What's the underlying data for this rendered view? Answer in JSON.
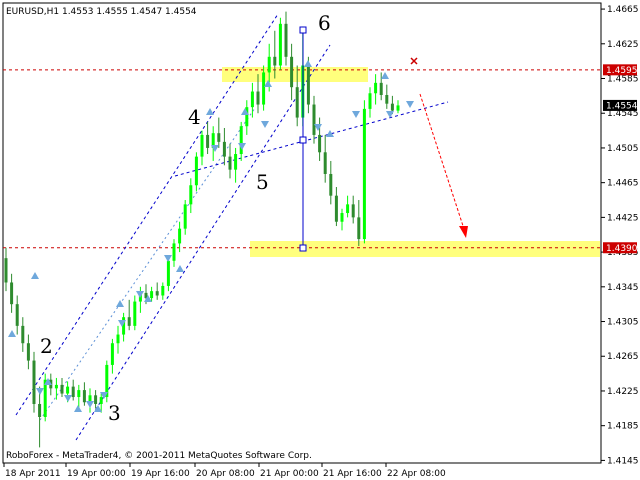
{
  "window": {
    "symbol_header": "EURUSD,H1  1.4553 1.4555 1.4547 1.4554",
    "footer": "RoboForex - MetaTrader4, © 2001-2011 MetaQuotes Software Corp."
  },
  "colors": {
    "bull": "#00ff00",
    "bear": "#2e8b2e",
    "line_blue": "#0000cc",
    "arrow_blue": "#6fa8dc",
    "level_red": "#cc0000",
    "zone_yellow": "#ffff66",
    "target_red": "#ff0000",
    "last_price_bg": "#000000"
  },
  "chart_data": {
    "type": "candlestick",
    "symbol": "EURUSD",
    "timeframe": "H1",
    "ylim": [
      1.4142,
      1.4672
    ],
    "y_ticks": [
      "1.4665",
      "1.4625",
      "1.4585",
      "1.4545",
      "1.4505",
      "1.4465",
      "1.4425",
      "1.4385",
      "1.4345",
      "1.4305",
      "1.4265",
      "1.4225",
      "1.4185",
      "1.4145"
    ],
    "x_ticks": [
      "18 Apr 2011",
      "19 Apr 00:00",
      "19 Apr 16:00",
      "20 Apr 08:00",
      "21 Apr 00:00",
      "21 Apr 16:00",
      "22 Apr 08:00"
    ],
    "price_levels": [
      {
        "label": "1.4595",
        "value": 1.4595
      },
      {
        "label": "1.4390",
        "value": 1.439
      }
    ],
    "last_price": {
      "label": "1.4554",
      "value": 1.4554
    },
    "wave_labels": [
      "2",
      "3",
      "4",
      "5",
      "6"
    ],
    "series": [
      {
        "values": [
          {
            "o": 1.4378,
            "h": 1.439,
            "l": 1.434,
            "c": 1.435
          },
          {
            "o": 1.435,
            "h": 1.436,
            "l": 1.4315,
            "c": 1.4325
          },
          {
            "o": 1.4325,
            "h": 1.4335,
            "l": 1.429,
            "c": 1.43
          },
          {
            "o": 1.43,
            "h": 1.431,
            "l": 1.427,
            "c": 1.428
          },
          {
            "o": 1.428,
            "h": 1.429,
            "l": 1.425,
            "c": 1.426
          },
          {
            "o": 1.426,
            "h": 1.427,
            "l": 1.42,
            "c": 1.421
          },
          {
            "o": 1.421,
            "h": 1.423,
            "l": 1.416,
            "c": 1.4195
          },
          {
            "o": 1.4195,
            "h": 1.4245,
            "l": 1.419,
            "c": 1.4238
          },
          {
            "o": 1.4238,
            "h": 1.4245,
            "l": 1.422,
            "c": 1.4228
          },
          {
            "o": 1.4228,
            "h": 1.424,
            "l": 1.4215,
            "c": 1.4232
          },
          {
            "o": 1.4232,
            "h": 1.424,
            "l": 1.4218,
            "c": 1.4222
          },
          {
            "o": 1.4222,
            "h": 1.4236,
            "l": 1.4212,
            "c": 1.423
          },
          {
            "o": 1.423,
            "h": 1.4238,
            "l": 1.4214,
            "c": 1.4218
          },
          {
            "o": 1.4218,
            "h": 1.4232,
            "l": 1.4205,
            "c": 1.4226
          },
          {
            "o": 1.4226,
            "h": 1.4235,
            "l": 1.4208,
            "c": 1.4212
          },
          {
            "o": 1.4212,
            "h": 1.4228,
            "l": 1.42,
            "c": 1.422
          },
          {
            "o": 1.422,
            "h": 1.4226,
            "l": 1.4205,
            "c": 1.421
          },
          {
            "o": 1.421,
            "h": 1.4222,
            "l": 1.42,
            "c": 1.4218
          },
          {
            "o": 1.4218,
            "h": 1.426,
            "l": 1.4212,
            "c": 1.4255
          },
          {
            "o": 1.4255,
            "h": 1.4285,
            "l": 1.4245,
            "c": 1.428
          },
          {
            "o": 1.428,
            "h": 1.43,
            "l": 1.4268,
            "c": 1.429
          },
          {
            "o": 1.429,
            "h": 1.4315,
            "l": 1.4282,
            "c": 1.431
          },
          {
            "o": 1.431,
            "h": 1.433,
            "l": 1.4295,
            "c": 1.43
          },
          {
            "o": 1.43,
            "h": 1.4335,
            "l": 1.4295,
            "c": 1.4328
          },
          {
            "o": 1.4328,
            "h": 1.4345,
            "l": 1.4315,
            "c": 1.4338
          },
          {
            "o": 1.4338,
            "h": 1.4348,
            "l": 1.4325,
            "c": 1.4332
          },
          {
            "o": 1.4332,
            "h": 1.4345,
            "l": 1.4328,
            "c": 1.434
          },
          {
            "o": 1.434,
            "h": 1.435,
            "l": 1.433,
            "c": 1.4335
          },
          {
            "o": 1.4335,
            "h": 1.435,
            "l": 1.433,
            "c": 1.4346
          },
          {
            "o": 1.4346,
            "h": 1.438,
            "l": 1.434,
            "c": 1.4375
          },
          {
            "o": 1.4375,
            "h": 1.44,
            "l": 1.4368,
            "c": 1.4395
          },
          {
            "o": 1.4395,
            "h": 1.442,
            "l": 1.4385,
            "c": 1.4412
          },
          {
            "o": 1.4412,
            "h": 1.4445,
            "l": 1.4405,
            "c": 1.444
          },
          {
            "o": 1.444,
            "h": 1.447,
            "l": 1.443,
            "c": 1.4462
          },
          {
            "o": 1.4462,
            "h": 1.45,
            "l": 1.4455,
            "c": 1.4495
          },
          {
            "o": 1.4495,
            "h": 1.4525,
            "l": 1.4485,
            "c": 1.452
          },
          {
            "o": 1.452,
            "h": 1.4535,
            "l": 1.4498,
            "c": 1.4505
          },
          {
            "o": 1.4505,
            "h": 1.453,
            "l": 1.449,
            "c": 1.4522
          },
          {
            "o": 1.4522,
            "h": 1.454,
            "l": 1.4505,
            "c": 1.4512
          },
          {
            "o": 1.4512,
            "h": 1.4528,
            "l": 1.4485,
            "c": 1.4495
          },
          {
            "o": 1.4495,
            "h": 1.451,
            "l": 1.447,
            "c": 1.448
          },
          {
            "o": 1.448,
            "h": 1.4505,
            "l": 1.4465,
            "c": 1.4498
          },
          {
            "o": 1.4498,
            "h": 1.4535,
            "l": 1.449,
            "c": 1.453
          },
          {
            "o": 1.453,
            "h": 1.456,
            "l": 1.452,
            "c": 1.4552
          },
          {
            "o": 1.4552,
            "h": 1.458,
            "l": 1.454,
            "c": 1.457
          },
          {
            "o": 1.457,
            "h": 1.459,
            "l": 1.4545,
            "c": 1.4555
          },
          {
            "o": 1.4555,
            "h": 1.46,
            "l": 1.4548,
            "c": 1.4592
          },
          {
            "o": 1.4592,
            "h": 1.4625,
            "l": 1.457,
            "c": 1.461
          },
          {
            "o": 1.461,
            "h": 1.464,
            "l": 1.4585,
            "c": 1.46
          },
          {
            "o": 1.46,
            "h": 1.4655,
            "l": 1.4595,
            "c": 1.4648
          },
          {
            "o": 1.4648,
            "h": 1.4662,
            "l": 1.46,
            "c": 1.461
          },
          {
            "o": 1.461,
            "h": 1.4625,
            "l": 1.456,
            "c": 1.4575
          },
          {
            "o": 1.4575,
            "h": 1.46,
            "l": 1.453,
            "c": 1.454
          },
          {
            "o": 1.454,
            "h": 1.4645,
            "l": 1.453,
            "c": 1.46
          },
          {
            "o": 1.46,
            "h": 1.461,
            "l": 1.4545,
            "c": 1.4555
          },
          {
            "o": 1.4555,
            "h": 1.4565,
            "l": 1.451,
            "c": 1.452
          },
          {
            "o": 1.452,
            "h": 1.454,
            "l": 1.449,
            "c": 1.45
          },
          {
            "o": 1.45,
            "h": 1.452,
            "l": 1.4465,
            "c": 1.4475
          },
          {
            "o": 1.4475,
            "h": 1.449,
            "l": 1.444,
            "c": 1.445
          },
          {
            "o": 1.445,
            "h": 1.446,
            "l": 1.4415,
            "c": 1.442
          },
          {
            "o": 1.442,
            "h": 1.4435,
            "l": 1.441,
            "c": 1.443
          },
          {
            "o": 1.443,
            "h": 1.445,
            "l": 1.4425,
            "c": 1.444
          },
          {
            "o": 1.444,
            "h": 1.445,
            "l": 1.4418,
            "c": 1.4425
          },
          {
            "o": 1.4425,
            "h": 1.4445,
            "l": 1.4392,
            "c": 1.44
          },
          {
            "o": 1.44,
            "h": 1.456,
            "l": 1.4395,
            "c": 1.455
          },
          {
            "o": 1.455,
            "h": 1.4575,
            "l": 1.454,
            "c": 1.4568
          },
          {
            "o": 1.4568,
            "h": 1.459,
            "l": 1.4555,
            "c": 1.458
          },
          {
            "o": 1.458,
            "h": 1.4592,
            "l": 1.456,
            "c": 1.4566
          },
          {
            "o": 1.4566,
            "h": 1.4578,
            "l": 1.455,
            "c": 1.4556
          },
          {
            "o": 1.4556,
            "h": 1.4565,
            "l": 1.4544,
            "c": 1.4548
          },
          {
            "o": 1.4548,
            "h": 1.456,
            "l": 1.4545,
            "c": 1.4554
          }
        ]
      }
    ]
  }
}
